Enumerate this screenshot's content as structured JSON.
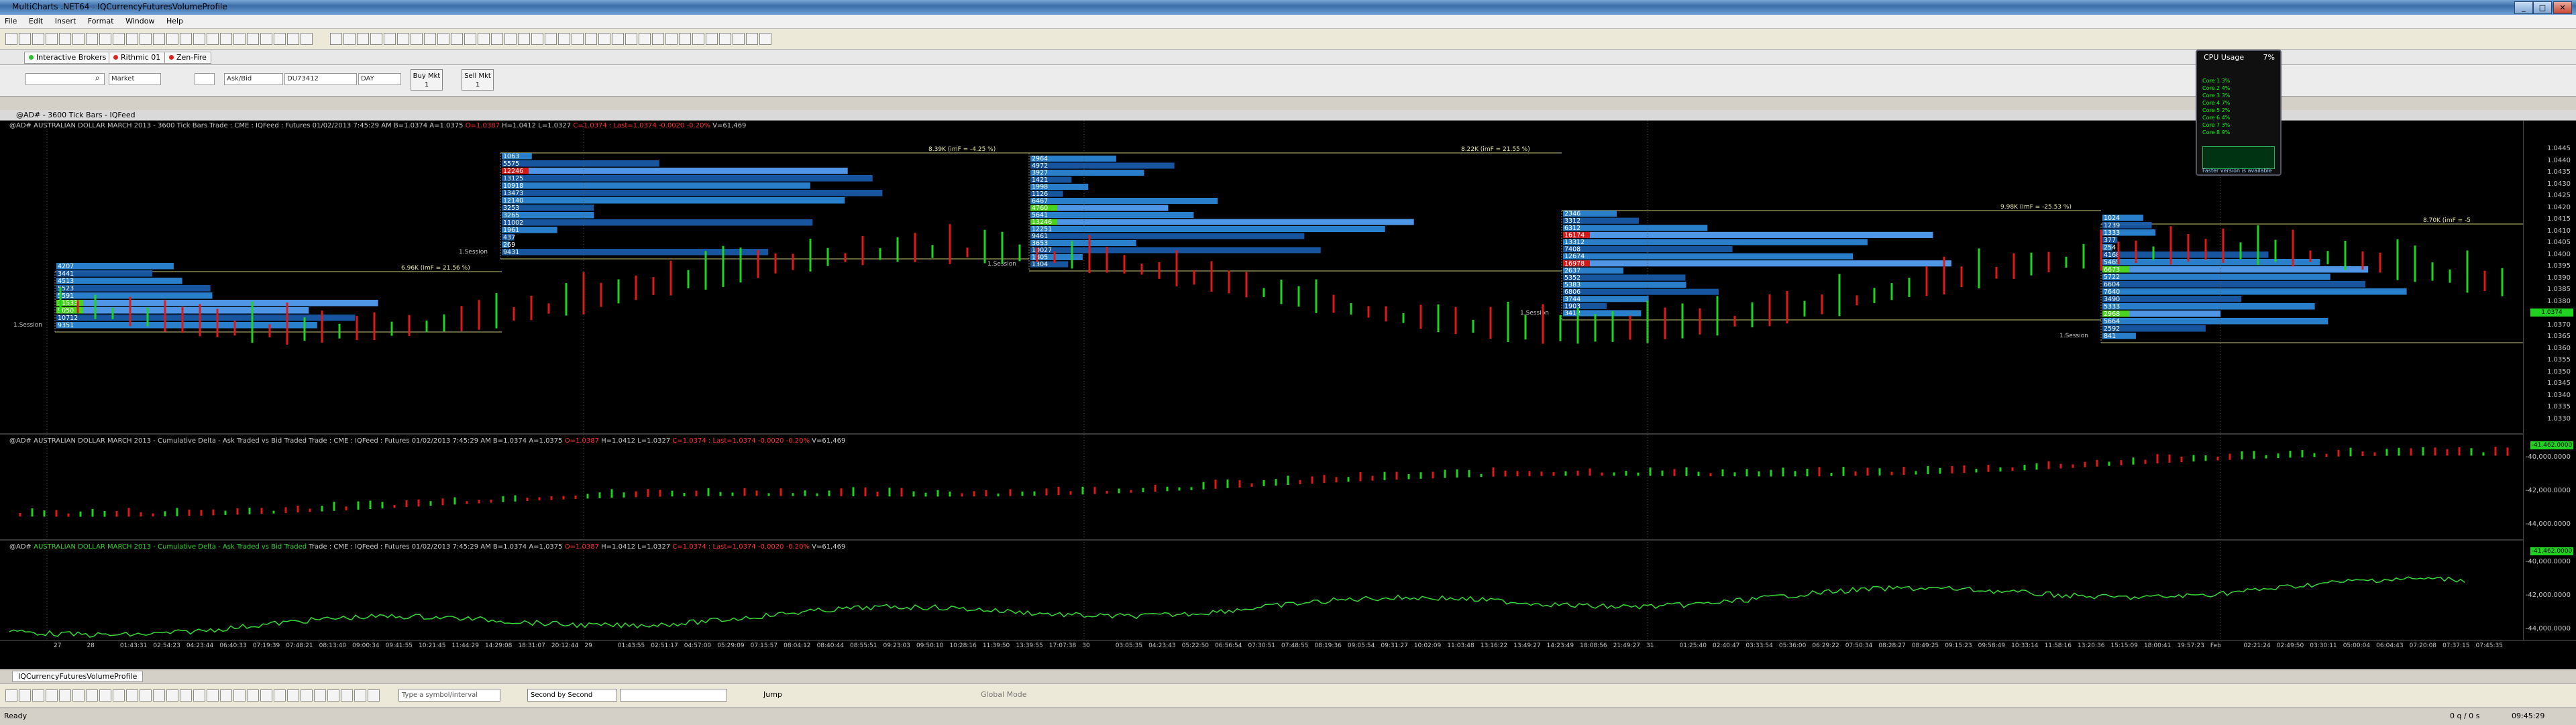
{
  "window": {
    "title": "MultiCharts .NET64 - IQCurrencyFuturesVolumeProfile",
    "controls": [
      "_",
      "□",
      "✕"
    ]
  },
  "menu": [
    "File",
    "Edit",
    "Insert",
    "Format",
    "Window",
    "Help"
  ],
  "broker_tabs": [
    {
      "label": "Interactive Brokers",
      "status_color": "#2bbf2b"
    },
    {
      "label": "Rithmic 01",
      "status_color": "#d22"
    },
    {
      "label": "Zen-Fire",
      "status_color": "#d22"
    }
  ],
  "order_bar": {
    "symbol": "",
    "account": "Market",
    "order_type": "Ask/Bid",
    "account_id": "DU73412",
    "tif": "DAY",
    "buy_label": "Buy Mkt",
    "buy_qty": "1",
    "sell_label": "Sell Mkt",
    "sell_qty": "1"
  },
  "chart_caption": "@AD# - 3600 Tick Bars - IQFeed",
  "panes": [
    {
      "symbol": "@AD#",
      "title": "AUSTRALIAN DOLLAR MARCH 2013 - 3600 Tick Bars",
      "source": "Trade : CME : IQFeed : Futures",
      "datetime": "01/02/2013 7:45:29 AM",
      "b": "B=1.0374",
      "a": "A=1.0375",
      "o": "O=1.0387",
      "h": "H=1.0412",
      "l": "L=1.0327",
      "c": "C=1.0374 : Last=1.0374 -0.0020 -0.20%",
      "v": "V=61,469"
    },
    {
      "symbol": "@AD#",
      "title": "AUSTRALIAN DOLLAR MARCH 2013 - Cumulative Delta - Ask Traded vs Bid Traded",
      "source": "Trade : CME : IQFeed : Futures",
      "datetime": "01/02/2013 7:45:29 AM",
      "b": "B=1.0374",
      "a": "A=1.0375",
      "o": "O=1.0387",
      "h": "H=1.0412",
      "l": "L=1.0327",
      "c": "C=1.0374 : Last=1.0374 -0.0020 -0.20%",
      "v": "V=61,469"
    },
    {
      "symbol": "@AD#",
      "title": "AUSTRALIAN DOLLAR MARCH 2013 - Cumulative Delta - Ask Traded vs Bid Traded",
      "source": "Trade : CME : IQFeed : Futures",
      "datetime": "01/02/2013 7:45:29 AM",
      "b": "B=1.0374",
      "a": "A=1.0375",
      "o": "O=1.0387",
      "h": "H=1.0412",
      "l": "L=1.0327",
      "c": "C=1.0374 : Last=1.0374 -0.0020 -0.20%",
      "v": "V=61,469"
    }
  ],
  "price_axis": [
    "1.0445",
    "1.0440",
    "1.0435",
    "1.0430",
    "1.0425",
    "1.0420",
    "1.0415",
    "1.0410",
    "1.0405",
    "1.0400",
    "1.0395",
    "1.0390",
    "1.0385",
    "1.0380",
    "1.0375",
    "1.0370",
    "1.0365",
    "1.0360",
    "1.0355",
    "1.0350",
    "1.0345",
    "1.0340",
    "1.0335",
    "1.0330"
  ],
  "price_tag": "1.0374",
  "delta_axis": [
    "-40,000.0000",
    "-42,000.0000",
    "-44,000.0000"
  ],
  "delta_tag": "-41,462.0000",
  "cum_axis": [
    "-40,000.0000",
    "-42,000.0000",
    "-44,000.0000"
  ],
  "cum_tag": "-41,462.0000",
  "volume_profiles": [
    {
      "levels": [
        "4207",
        "3441",
        "4513",
        "5523",
        "5591",
        "11533",
        "9050",
        "10712",
        "9351"
      ],
      "highlight": [
        "11533",
        "9050"
      ],
      "poc_label": "6.96K (imF = 21.56 %)",
      "session_label": "1.Session"
    },
    {
      "levels": [
        "1063",
        "5575",
        "12246",
        "13125",
        "10918",
        "13473",
        "12140",
        "3253",
        "3265",
        "11002",
        "1961",
        "437",
        "269",
        "9431"
      ],
      "highlight": [
        "12246"
      ],
      "poc_label": "8.39K (imF = -4.25 %)",
      "session_label": "1.Session"
    },
    {
      "levels": [
        "2964",
        "4972",
        "3927",
        "1421",
        "1998",
        "1126",
        "6467",
        "4760",
        "5641",
        "13246",
        "12251",
        "9461",
        "3653",
        "10027",
        "1805",
        "1304"
      ],
      "highlight": [
        "4760",
        "13246"
      ],
      "poc_label": "8.22K (imF = 21.55 %)",
      "session_label": "1.Session"
    },
    {
      "levels": [
        "2346",
        "3312",
        "6312",
        "16174",
        "13312",
        "7408",
        "12674",
        "16978",
        "2637",
        "5352",
        "5383",
        "6806",
        "3744",
        "1903",
        "3412"
      ],
      "highlight": [
        "16174",
        "16978"
      ],
      "poc_label": "9.98K (imF = -25.53 %)",
      "session_label": "1.Session"
    },
    {
      "levels": [
        "1024",
        "1239",
        "1333",
        "377",
        "254",
        "4168",
        "5465",
        "6673",
        "5722",
        "6604",
        "7640",
        "3490",
        "5333",
        "2968",
        "5664",
        "2592",
        "841"
      ],
      "highlight": [
        "6673",
        "2968"
      ],
      "poc_label": "8.70K (imF = -5",
      "session_label": "1.Session"
    }
  ],
  "time_axis": [
    "27",
    "28",
    "01:43:31",
    "02:54:23",
    "04:23:44",
    "06:40:33",
    "07:19:39",
    "07:48:21",
    "08:13:40",
    "09:00:34",
    "09:41:55",
    "10:21:45",
    "11:44:29",
    "14:29:08",
    "18:31:07",
    "20:12:44",
    "29",
    "01:43:55",
    "02:51:17",
    "04:57:00",
    "05:29:09",
    "07:15:57",
    "08:04:12",
    "08:40:44",
    "08:55:51",
    "09:23:03",
    "09:50:10",
    "10:28:16",
    "11:39:50",
    "13:39:55",
    "17:07:38",
    "30",
    "03:05:35",
    "04:23:43",
    "05:22:50",
    "06:56:54",
    "07:30:51",
    "07:48:55",
    "08:19:36",
    "09:05:54",
    "09:31:27",
    "10:02:09",
    "11:03:48",
    "13:16:22",
    "13:49:27",
    "14:23:49",
    "18:08:56",
    "21:49:27",
    "31",
    "01:25:40",
    "02:40:47",
    "03:33:54",
    "05:36:00",
    "06:29:22",
    "07:50:34",
    "08:28:27",
    "08:49:25",
    "09:15:23",
    "09:58:49",
    "10:33:14",
    "11:58:16",
    "13:20:36",
    "15:15:09",
    "18:00:41",
    "19:57:23",
    "Feb",
    "02:21:24",
    "02:49:50",
    "03:30:11",
    "05:00:04",
    "06:04:43",
    "07:20:08",
    "07:37:15",
    "07:45:35"
  ],
  "doc_tab": "IQCurrencyFuturesVolumeProfile",
  "drawing_bar": {
    "symbol_placeholder": "Type a symbol/interval",
    "resolution": "Second by Second",
    "jump": "Jump",
    "global_mode": "Global Mode"
  },
  "status": {
    "ready": "Ready",
    "qps": "0 q / 0 s",
    "time": "09:45:29"
  },
  "cpu_gadget": {
    "title": "CPU Usage",
    "pct": "7%",
    "rows": [
      "Core 1 3%",
      "Core 2 4%",
      "Core 3 3%",
      "Core 4 7%",
      "Core 5 2%",
      "Core 6 4%",
      "Core 7 3%",
      "Core 8 9%"
    ],
    "footer": "Faster version is available"
  },
  "colors": {
    "up": "#21d321",
    "down": "#e21919",
    "profile": "#1a5fb0",
    "profile_light": "#2f8de0",
    "poc": "#58a7ff",
    "level_line": "#c8c878",
    "delta_line": "#36d836"
  }
}
